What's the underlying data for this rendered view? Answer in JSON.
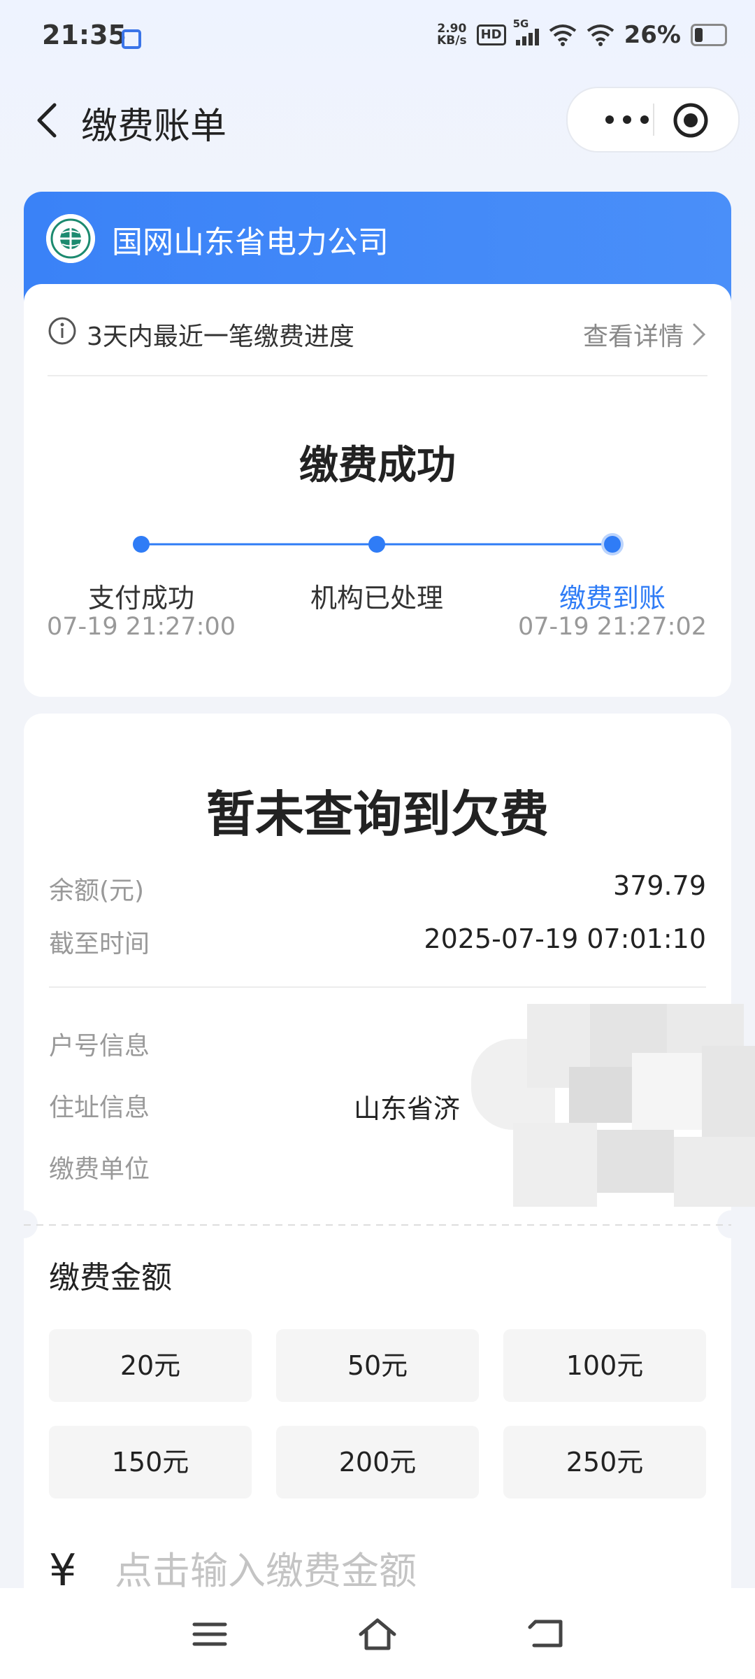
{
  "status_bar": {
    "time": "21:35",
    "speed_value": "2.90",
    "speed_unit": "KB/s",
    "hd_label": "HD",
    "network_label": "5G",
    "battery": "26%"
  },
  "nav": {
    "title": "缴费账单"
  },
  "payment_card": {
    "org_name": "国网山东省电力公司",
    "info_text": "3天内最近一笔缴费进度",
    "detail_link": "查看详情",
    "status_title": "缴费成功",
    "steps": [
      {
        "label": "支付成功",
        "time": "07-19 21:27:00"
      },
      {
        "label": "机构已处理",
        "time": ""
      },
      {
        "label": "缴费到账",
        "time": "07-19 21:27:02"
      }
    ]
  },
  "bill_card": {
    "headline": "暂未查询到欠费",
    "balance_label": "余额(元)",
    "balance_value": "379.79",
    "asof_label": "截至时间",
    "asof_value": "2025-07-19 07:01:10",
    "account_label": "户号信息",
    "address_label": "住址信息",
    "address_value": "山东省济",
    "unit_label": "缴费单位",
    "amount_title": "缴费金额",
    "amounts": [
      "20元",
      "50元",
      "100元",
      "150元",
      "200元",
      "250元"
    ],
    "currency_symbol": "¥",
    "input_placeholder": "点击输入缴费金额"
  },
  "colors": {
    "accent": "#2f7cf6",
    "header_gradient_start": "#3a82f7",
    "muted_text": "#999999"
  },
  "icons": [
    "back-icon",
    "more-icon",
    "target-icon",
    "info-icon",
    "chevron-right-icon",
    "state-grid-logo-icon",
    "menu-icon",
    "home-icon",
    "back-nav-icon"
  ]
}
